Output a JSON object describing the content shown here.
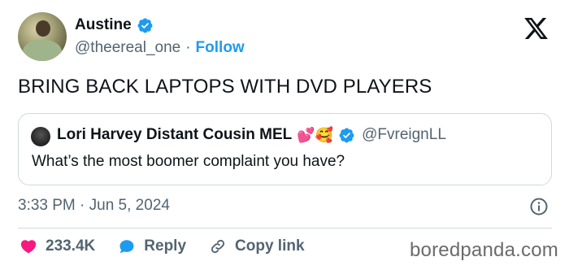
{
  "author": {
    "name": "Austine",
    "handle": "@theereal_one",
    "separator": "·",
    "follow_label": "Follow"
  },
  "tweet": {
    "text": "BRING BACK LAPTOPS WITH DVD PLAYERS",
    "timestamp": "3:33 PM · Jun 5, 2024"
  },
  "quoted": {
    "name": "Lori Harvey Distant Cousin MEL",
    "emojis": "💕🥰",
    "handle": "@FvreignLL",
    "text": "What’s the most boomer complaint you have?"
  },
  "actions": {
    "likes": "233.4K",
    "reply_label": "Reply",
    "copy_label": "Copy link"
  },
  "watermark": "boredpanda.com",
  "colors": {
    "accent": "#1d9bf0",
    "heart": "#f91880",
    "muted": "#536471",
    "border": "#cfd9de"
  }
}
